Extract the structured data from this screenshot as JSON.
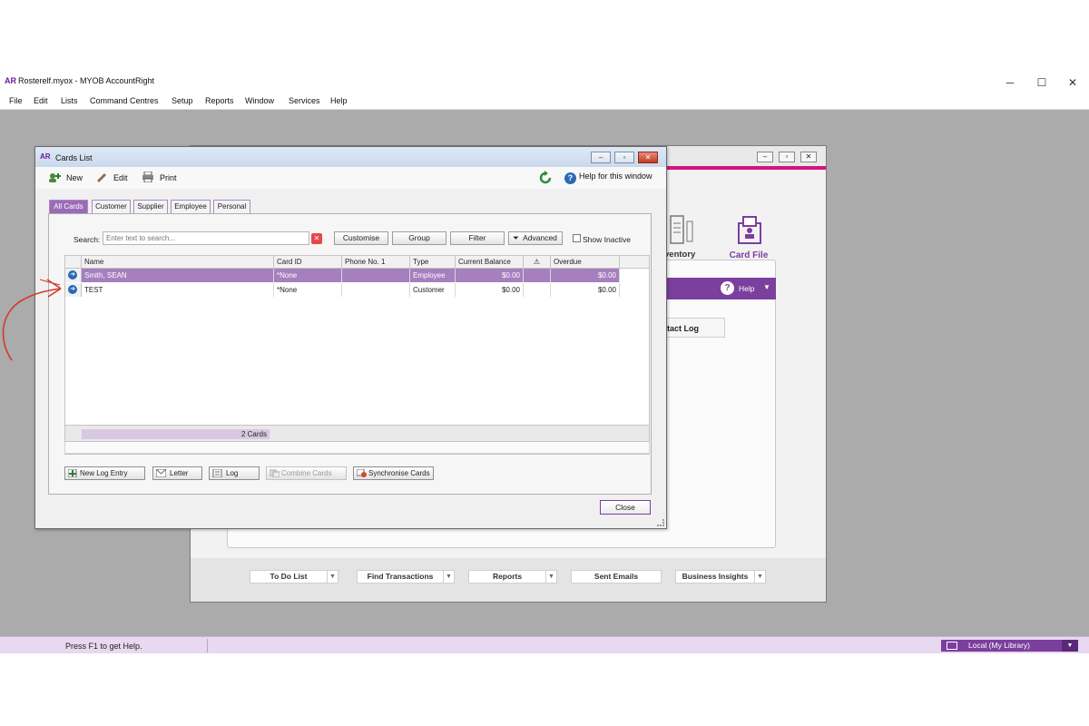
{
  "app": {
    "logo": "AR",
    "title": "Rosterelf.myox - MYOB AccountRight",
    "controls": {
      "minimize": "─",
      "maximize": "☐",
      "close": "✕"
    }
  },
  "menu": [
    "File",
    "Edit",
    "Lists",
    "Command Centres",
    "Setup",
    "Reports",
    "Window",
    "Services",
    "Help"
  ],
  "command_centre": {
    "inventory_label": "ventory",
    "card_file_label": "Card File",
    "help_label": "Help",
    "contact_log_label": "tact Log",
    "bottom_buttons": [
      "To Do List",
      "Find Transactions",
      "Reports",
      "Sent Emails",
      "Business Insights"
    ]
  },
  "cards_list": {
    "logo": "AR",
    "title": "Cards List",
    "toolbar": {
      "new": "New",
      "edit": "Edit",
      "print": "Print",
      "help": "Help for this window"
    },
    "tabs": [
      "All Cards",
      "Customer",
      "Supplier",
      "Employee",
      "Personal"
    ],
    "active_tab": "All Cards",
    "search": {
      "label": "Search:",
      "placeholder": "Enter text to search..."
    },
    "filter_buttons": {
      "customise": "Customise",
      "group": "Group",
      "filter": "Filter",
      "advanced": "Advanced"
    },
    "show_inactive": "Show Inactive",
    "columns": [
      "Name",
      "Card ID",
      "Phone No. 1",
      "Type",
      "Current Balance",
      "⚠",
      "Overdue"
    ],
    "rows": [
      {
        "name": "Smith, SEAN",
        "card_id": "*None",
        "phone": "",
        "type": "Employee",
        "balance": "$0.00",
        "flag": "",
        "overdue": "$0.00",
        "selected": true
      },
      {
        "name": "TEST",
        "card_id": "*None",
        "phone": "",
        "type": "Customer",
        "balance": "$0.00",
        "flag": "",
        "overdue": "$0.00",
        "selected": false
      }
    ],
    "count": "2 Cards",
    "bottom_buttons": {
      "new_log": "New Log Entry",
      "letter": "Letter",
      "log": "Log",
      "combine": "Combine Cards",
      "sync": "Synchronise Cards"
    },
    "close": "Close"
  },
  "status": {
    "help": "Press F1 to get Help.",
    "library": "Local (My Library)"
  },
  "colors": {
    "accent": "#7b3f9e",
    "pink": "#d6137f",
    "annotation": "#d03a2a"
  }
}
